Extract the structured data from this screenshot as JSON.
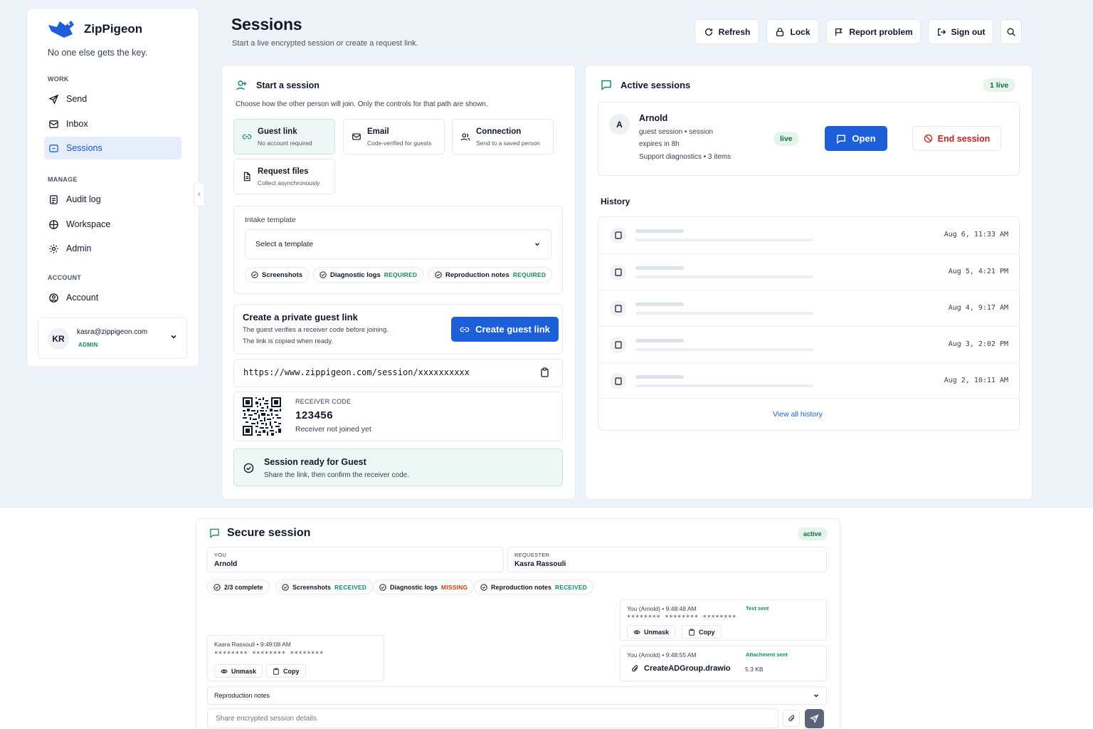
{
  "app": {
    "name": "ZipPigeon",
    "tagline": "No one else gets the key."
  },
  "sidebar": {
    "sections": [
      {
        "label": "WORK",
        "items": [
          {
            "label": "Send",
            "icon": "send-icon"
          },
          {
            "label": "Inbox",
            "icon": "inbox-icon"
          },
          {
            "label": "Sessions",
            "icon": "sessions-icon",
            "active": true
          }
        ]
      },
      {
        "label": "MANAGE",
        "items": [
          {
            "label": "Audit log",
            "icon": "audit-log-icon"
          },
          {
            "label": "Workspace",
            "icon": "workspace-icon"
          },
          {
            "label": "Admin",
            "icon": "admin-icon"
          }
        ]
      },
      {
        "label": "ACCOUNT",
        "items": [
          {
            "label": "Account",
            "icon": "account-icon"
          }
        ]
      }
    ],
    "user": {
      "initials": "KR",
      "email": "kasra@zippigeon.com",
      "role": "ADMIN"
    }
  },
  "header": {
    "title": "Sessions",
    "subtitle": "Start a live encrypted session or create a request link."
  },
  "toolbar": {
    "refresh": "Refresh",
    "lock": "Lock",
    "report": "Report problem",
    "signout": "Sign out"
  },
  "start": {
    "title": "Start a session",
    "description": "Choose how the other person will join. Only the controls for that path are shown.",
    "options": [
      {
        "label": "Guest link",
        "sub": "No account required",
        "selected": true
      },
      {
        "label": "Email",
        "sub": "Code-verified for guests"
      },
      {
        "label": "Connection",
        "sub": "Send to a saved person"
      },
      {
        "label": "Request files",
        "sub": "Collect asynchronously"
      }
    ],
    "intake": {
      "label": "Intake template",
      "placeholder": "Select a template"
    },
    "chips": [
      {
        "label": "Screenshots",
        "tag": ""
      },
      {
        "label": "Diagnostic logs",
        "tag": "REQUIRED"
      },
      {
        "label": "Reproduction notes",
        "tag": "REQUIRED"
      }
    ],
    "guest": {
      "title": "Create a private guest link",
      "line1": "The guest verifies a receiver code before joining.",
      "line2": "The link is copied when ready.",
      "button": "Create guest link"
    },
    "link": "https://www.zippigeon.com/session/xxxxxxxxxx",
    "receiver": {
      "label": "RECEIVER CODE",
      "code": "123456",
      "status": "Receiver not joined yet"
    },
    "ready": {
      "title": "Session ready for Guest",
      "sub": "Share the link, then confirm the receiver code."
    }
  },
  "active": {
    "title": "Active sessions",
    "badge": "1 live",
    "session": {
      "initial": "A",
      "name": "Arnold",
      "line1": "guest session • session",
      "line2": "expires in 8h",
      "line3": "Support diagnostics • 3 items",
      "status": "live",
      "open": "Open",
      "end": "End session"
    },
    "history_title": "History",
    "history": [
      "Aug 6, 11:33 AM",
      "Aug 5, 4:21 PM",
      "Aug 4, 9:17 AM",
      "Aug 3, 2:02 PM",
      "Aug 2, 10:11 AM"
    ],
    "view_all": "View all history"
  },
  "secure": {
    "title": "Secure session",
    "status": "active",
    "you_label": "YOU",
    "you": "Arnold",
    "requester_label": "REQUESTER",
    "requester": "Kasra Rassouli",
    "chips": [
      {
        "label": "2/3 complete",
        "tag": ""
      },
      {
        "label": "Screenshots",
        "tag": "RECEIVED"
      },
      {
        "label": "Diagnostic logs",
        "tag": "MISSING"
      },
      {
        "label": "Reproduction notes",
        "tag": "RECEIVED"
      }
    ],
    "msg1": {
      "meta": "You (Arnold) • 9:48:48 AM",
      "tag": "Text sent",
      "masked": "********   ********   ********",
      "unmask": "Unmask",
      "copy": "Copy"
    },
    "msg2": {
      "meta": "Kasra Rassouli • 9:49:08 AM",
      "masked": "********   ********   ********",
      "unmask": "Unmask",
      "copy": "Copy"
    },
    "msg3": {
      "meta": "You (Arnold) • 9:48:55 AM",
      "tag": "Attachment sent",
      "file": "CreateADGroup.drawio",
      "size": "5.3 KB"
    },
    "notes_select": "Reproduction notes",
    "input_placeholder": "Share encrypted session details"
  },
  "colors": {
    "accent": "#1d5fd8",
    "success": "#0f8a6a",
    "danger": "#c81e1e",
    "warning": "#c2410c"
  }
}
